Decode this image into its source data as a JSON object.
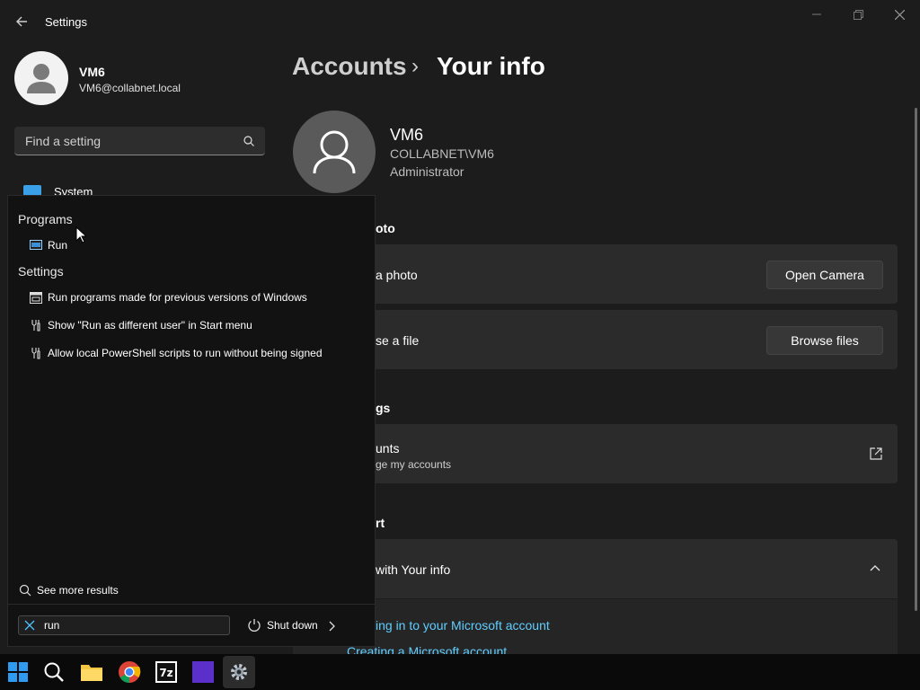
{
  "window": {
    "title": "Settings",
    "back_icon": "back-arrow-icon",
    "controls": [
      "minimize-icon",
      "restore-icon",
      "close-icon"
    ]
  },
  "profile": {
    "name": "VM6",
    "email": "VM6@collabnet.local"
  },
  "search": {
    "placeholder": "Find a setting"
  },
  "sidebar": {
    "items": [
      {
        "label": "System",
        "icon": "system-icon"
      }
    ]
  },
  "main": {
    "breadcrumb": {
      "parent": "Accounts",
      "separator": "›",
      "current": "Your info"
    },
    "user": {
      "name": "VM6",
      "domain": "COLLABNET\\VM6",
      "role": "Administrator"
    },
    "sections": {
      "photo_header": "oto",
      "photo_row1": "a photo",
      "photo_row1_button": "Open Camera",
      "photo_row2": "se a file",
      "photo_row2_button": "Browse files",
      "settings_header": "gs",
      "accounts_title": "unts",
      "accounts_sub": "ge my accounts",
      "support_header": "rt",
      "help_row": "with Your info",
      "link1": "ing in to your Microsoft account",
      "link2": "Creating a Microsoft account"
    }
  },
  "start_menu": {
    "groups": [
      {
        "title": "Programs",
        "items": [
          {
            "label": "Run",
            "icon": "run-icon"
          }
        ]
      },
      {
        "title": "Settings",
        "items": [
          {
            "label": "Run programs made for previous versions of Windows",
            "icon": "compatibility-icon"
          },
          {
            "label": "Show \"Run as different user\" in Start menu",
            "icon": "settings-wrench-icon"
          },
          {
            "label": "Allow local PowerShell scripts to run without being signed",
            "icon": "settings-wrench-icon"
          }
        ]
      }
    ],
    "see_more": "See more results",
    "search_value": "run",
    "shutdown": "Shut down"
  },
  "taskbar": {
    "items": [
      "windows-start-icon",
      "search-icon",
      "file-explorer-icon",
      "chrome-icon",
      "7zip-icon",
      "app-purple-icon",
      "settings-gear-icon"
    ]
  },
  "colors": {
    "background": "#1c1c1c",
    "card": "#2b2b2b",
    "accent_link": "#60cdff",
    "start_menu_bg": "#121212"
  }
}
